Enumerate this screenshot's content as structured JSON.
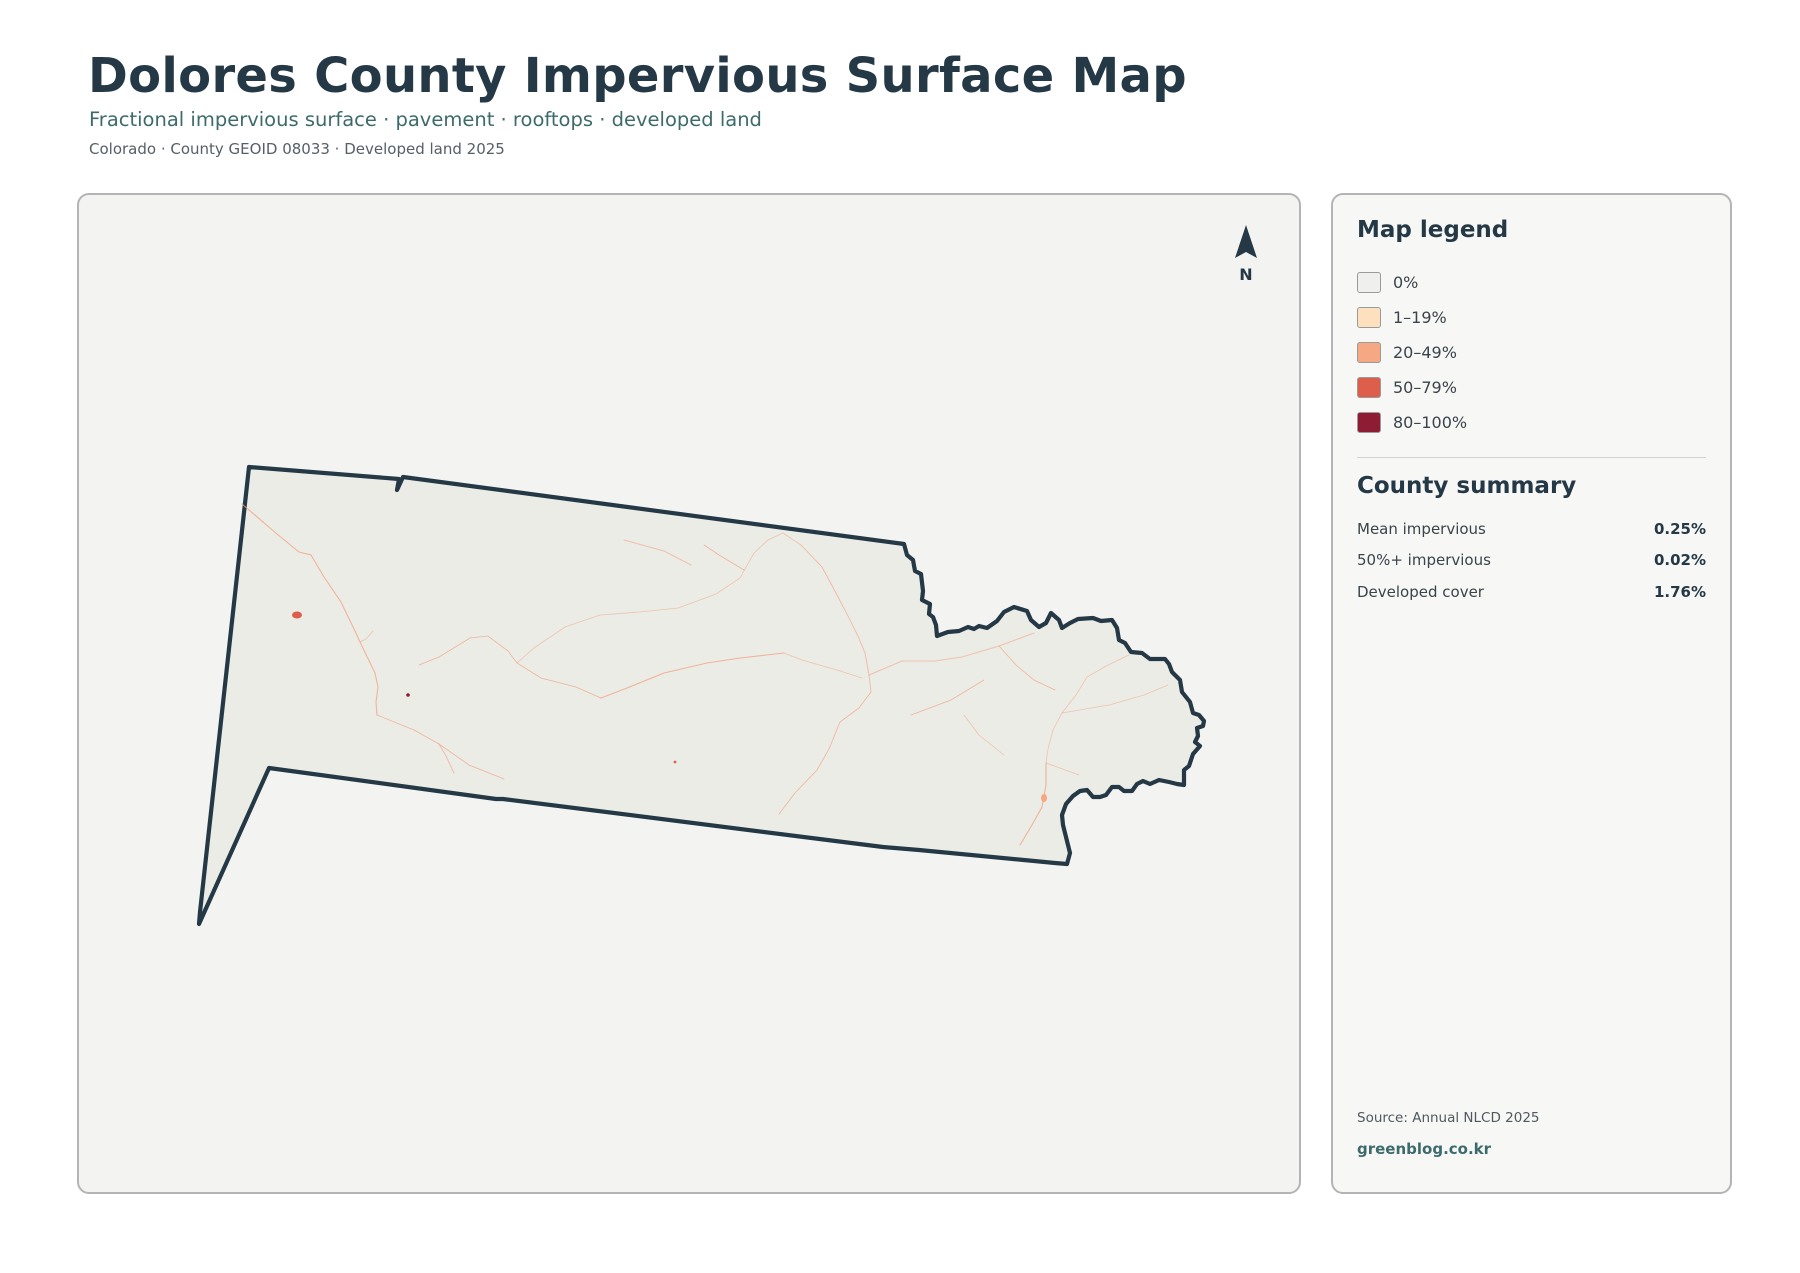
{
  "header": {
    "title": "Dolores County Impervious Surface Map",
    "subtitle": "Fractional impervious surface · pavement · rooftops · developed land",
    "meta": "Colorado · County GEOID 08033 · Developed land 2025"
  },
  "map": {
    "north_label": "N",
    "county_fill": "#ebece6",
    "outline_color": "#243845",
    "road_color": "#f2a07f"
  },
  "legend": {
    "title": "Map legend",
    "items": [
      {
        "label": "0%",
        "color": "#efefed"
      },
      {
        "label": "1–19%",
        "color": "#fde0bd"
      },
      {
        "label": "20–49%",
        "color": "#f5a882"
      },
      {
        "label": "50–79%",
        "color": "#de5e4c"
      },
      {
        "label": "80–100%",
        "color": "#8e1c32"
      }
    ]
  },
  "summary": {
    "title": "County summary",
    "rows": [
      {
        "label": "Mean impervious",
        "value": "0.25%"
      },
      {
        "label": "50%+ impervious",
        "value": "0.02%"
      },
      {
        "label": "Developed cover",
        "value": "1.76%"
      }
    ]
  },
  "footer": {
    "source": "Source: Annual NLCD 2025",
    "brand": "greenblog.co.kr"
  }
}
